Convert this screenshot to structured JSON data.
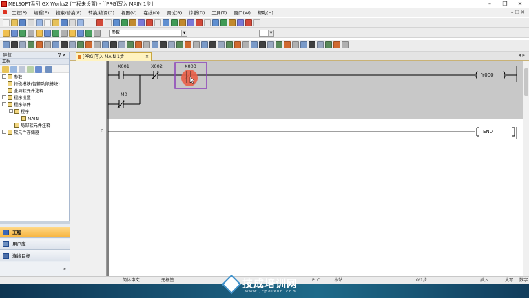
{
  "window": {
    "title": "MELSOFT系列 GX Works2 (工程未设置) - [[PRG]写入 MAIN 1步]",
    "minimize": "–",
    "restore": "❐",
    "close": "✕",
    "menu_restore": "–  ❐  ✕"
  },
  "menu": [
    "工程(P)",
    "编辑(E)",
    "搜索/替换(F)",
    "转换/编译(C)",
    "视图(V)",
    "在线(O)",
    "调试(B)",
    "诊断(D)",
    "工具(T)",
    "窗口(W)",
    "帮助(H)"
  ],
  "toolbar2": {
    "combo_value": "参数"
  },
  "nav": {
    "header": "导航",
    "pin": "ᐁ ✕",
    "sub_header": "工程",
    "tree": [
      {
        "label": "参数",
        "depth": 0,
        "expander": "⊟"
      },
      {
        "label": "特殊模块(智能功能模块)",
        "depth": 0,
        "expander": ""
      },
      {
        "label": "全局软元件注释",
        "depth": 0,
        "expander": ""
      },
      {
        "label": "程序设置",
        "depth": 0,
        "expander": "⊞"
      },
      {
        "label": "程序部件",
        "depth": 0,
        "expander": "⊟"
      },
      {
        "label": "程序",
        "depth": 1,
        "expander": "⊟"
      },
      {
        "label": "MAIN",
        "depth": 2,
        "expander": ""
      },
      {
        "label": "局部软元件注释",
        "depth": 1,
        "expander": ""
      },
      {
        "label": "软元件存储器",
        "depth": 0,
        "expander": "⊞"
      }
    ],
    "tabs": [
      {
        "label": "工程",
        "active": true
      },
      {
        "label": "用户库",
        "active": false
      },
      {
        "label": "连接目标",
        "active": false
      }
    ],
    "more": "»"
  },
  "doc": {
    "tab_label": "[PRG]写入 MAIN 1步",
    "tab_close": "✕",
    "nav_arrows": "◂ ▸",
    "rung0_step": "0",
    "contacts": {
      "x001": "X001",
      "x002": "X002",
      "x003": "X003",
      "m0": "M0"
    },
    "coil": "Y000",
    "end": "END"
  },
  "status": {
    "lang": "简体中文",
    "title": "无标签",
    "plc": "PLC",
    "station": "本站",
    "steps": "0/1步",
    "mode": "插入",
    "caps": "大写",
    "num": "数字"
  },
  "watermark": {
    "brand": "技成培训网",
    "url": "www.jcpeixun.com"
  },
  "colors": {
    "cursor_highlight": "#e8624a",
    "selection_box": "#8a3fb8",
    "taskbar": "#1a5878",
    "active_nav_tab": "#f7b33d"
  }
}
